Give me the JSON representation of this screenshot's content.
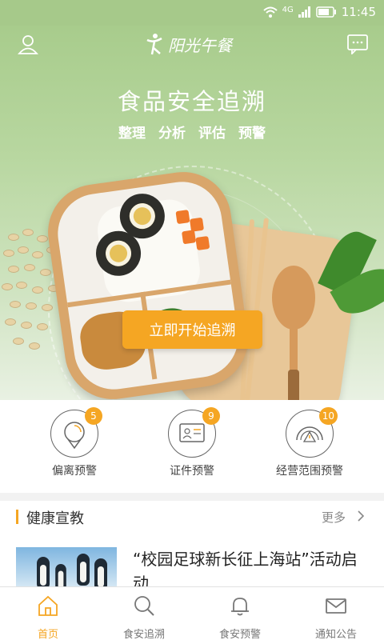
{
  "status_bar": {
    "time": "11:45",
    "network": "4G",
    "icons": [
      "wifi-icon",
      "signal-icon",
      "battery-icon"
    ]
  },
  "header": {
    "brand_name": "阳光午餐",
    "left_icon": "user-icon",
    "right_icon": "message-icon"
  },
  "hero": {
    "title": "食品安全追溯",
    "subtitles": [
      "整理",
      "分析",
      "评估",
      "预警"
    ],
    "cta_label": "立即开始追溯"
  },
  "warnings": [
    {
      "label": "偏离预警",
      "count": "5",
      "icon": "location-pin-icon"
    },
    {
      "label": "证件预警",
      "count": "9",
      "icon": "id-card-icon"
    },
    {
      "label": "经营范围预警",
      "count": "10",
      "icon": "range-alert-icon"
    }
  ],
  "health": {
    "title": "健康宣教",
    "more_label": "更多",
    "news": [
      {
        "title": "“校园足球新长征上海站”活动启动"
      }
    ]
  },
  "tabs": [
    {
      "label": "首页",
      "icon": "home-icon",
      "active": true
    },
    {
      "label": "食安追溯",
      "icon": "search-icon",
      "active": false
    },
    {
      "label": "食安预警",
      "icon": "bell-icon",
      "active": false
    },
    {
      "label": "通知公告",
      "icon": "mail-icon",
      "active": false
    }
  ],
  "colors": {
    "accent": "#f5a623",
    "hero_green": "#a8cc8c",
    "inactive": "#777777"
  }
}
